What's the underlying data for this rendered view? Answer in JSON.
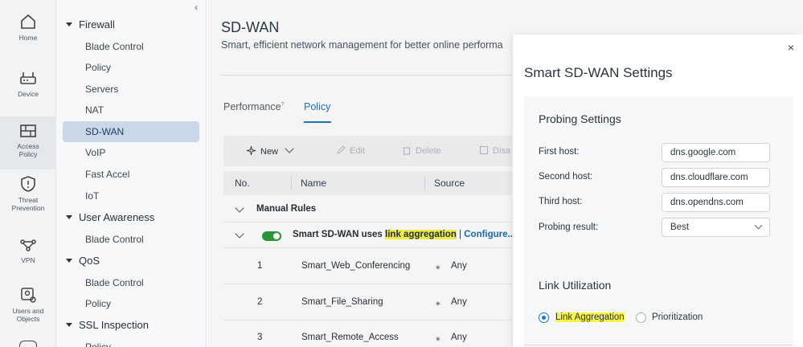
{
  "rail": {
    "items": [
      {
        "label": "Home",
        "icon": "home-icon"
      },
      {
        "label": "Device",
        "icon": "router-icon"
      },
      {
        "label": "Access Policy",
        "icon": "firewall-icon"
      },
      {
        "label": "Threat Prevention",
        "icon": "shield-icon"
      },
      {
        "label": "VPN",
        "icon": "vpn-icon"
      },
      {
        "label": "Users and Objects",
        "icon": "users-icon"
      }
    ]
  },
  "tree": {
    "collapse": "‹",
    "groups": {
      "firewall": "Firewall",
      "user_awareness": "User Awareness",
      "qos": "QoS",
      "ssl": "SSL Inspection"
    },
    "items": {
      "blade_control": "Blade Control",
      "policy": "Policy",
      "servers": "Servers",
      "nat": "NAT",
      "sdwan": "SD-WAN",
      "voip": "VoIP",
      "fast_accel": "Fast Accel",
      "iot": "IoT",
      "ua_blade_control": "Blade Control",
      "qos_blade_control": "Blade Control",
      "qos_policy": "Policy",
      "ssl_policy": "Policy"
    }
  },
  "main": {
    "title": "SD-WAN",
    "subtitle": "Smart, efficient network management for better online performa",
    "tabs": {
      "performance": "Performance",
      "performance_sup": "?",
      "policy": "Policy"
    },
    "toolbar": {
      "new": "New",
      "edit": "Edit",
      "delete": "Delete",
      "disable": "Disa"
    },
    "columns": {
      "no": "No.",
      "name": "Name",
      "source": "Source"
    },
    "manual_rules": "Manual Rules",
    "smart_rule": {
      "prefix": "Smart SD-WAN uses ",
      "highlight": "link aggregation",
      "sep": " | ",
      "configure": "Configure..."
    },
    "rows": [
      {
        "no": "1",
        "name": "Smart_Web_Conferencing",
        "source": "Any"
      },
      {
        "no": "2",
        "name": "Smart_File_Sharing",
        "source": "Any"
      },
      {
        "no": "3",
        "name": "Smart_Remote_Access",
        "source": "Any"
      }
    ]
  },
  "modal": {
    "title": "Smart SD-WAN Settings",
    "close": "×",
    "probing": {
      "heading": "Probing Settings",
      "first_label": "First host:",
      "first_value": "dns.google.com",
      "second_label": "Second host:",
      "second_value": "dns.cloudflare.com",
      "third_label": "Third host:",
      "third_value": "dns.opendns.com",
      "result_label": "Probing result:",
      "result_value": "Best"
    },
    "link": {
      "heading": "Link Utilization",
      "aggregation": "Link Aggregation",
      "prioritization": "Prioritization",
      "selected": "aggregation"
    }
  },
  "colors": {
    "accent": "#1b78c8",
    "toggle_on": "#2e9b3f",
    "highlight": "#f7f34a",
    "nav_active": "#c9d8e6"
  }
}
